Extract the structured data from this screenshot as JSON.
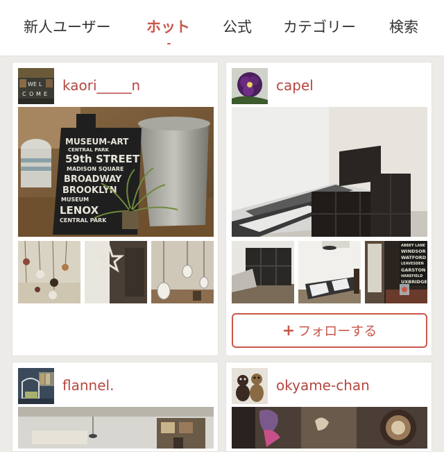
{
  "tabs": [
    {
      "label": "新人ユーザー",
      "active": false
    },
    {
      "label": "ホット",
      "active": true
    },
    {
      "label": "公式",
      "active": false
    },
    {
      "label": "カテゴリー",
      "active": false
    },
    {
      "label": "検索",
      "active": false
    }
  ],
  "colors": {
    "accent": "#c9574b",
    "username": "#b6463f",
    "background": "#ecebe8"
  },
  "cards": [
    {
      "username": "kaori_____n"
    },
    {
      "username": "capel",
      "follow_label": "フォローする",
      "follow_icon": "plus-icon"
    },
    {
      "username": "flannel."
    },
    {
      "username": "okyame-chan"
    }
  ],
  "photo_text": {
    "sign_lines": [
      "MUSEUM-ART",
      "CENTRAL PARK",
      "59th STREET",
      "MADISON SQUARE",
      "BROADWAY",
      "BROOKLYN",
      "MUSEUM",
      "LENOX",
      "CENTRAL PARK"
    ],
    "welcome_letters": [
      "W",
      "E",
      "L",
      "C",
      "O",
      "M",
      "E"
    ],
    "subway_lines": [
      "ABBEY LANE",
      "WINDSOR",
      "WATFORD",
      "LEAVESDEN",
      "GARSTON",
      "HAREFIELD",
      "UXBRIDGE"
    ]
  }
}
